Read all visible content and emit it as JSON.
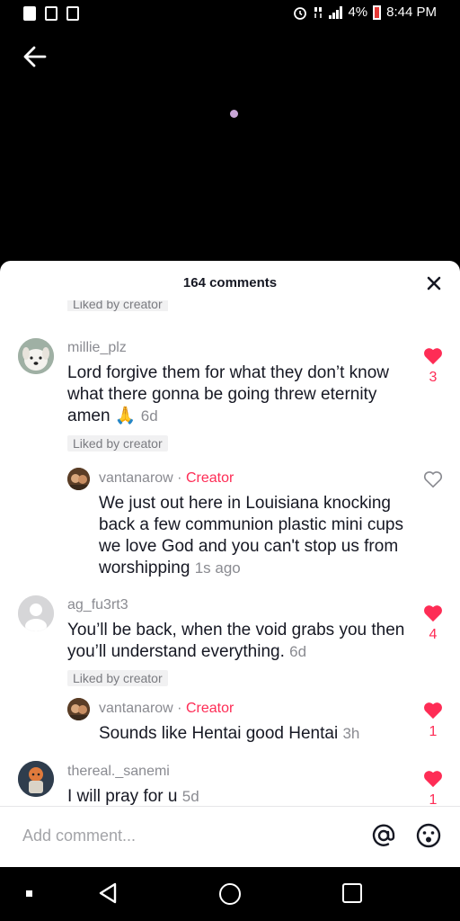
{
  "status_bar": {
    "battery": "4%",
    "time": "8:44 PM"
  },
  "header": {
    "title": "164 comments"
  },
  "comments": [
    {
      "username": "millie_plz",
      "text": "Lord forgive them for what they don’t know what there gonna be going threw eternity amen 🙏",
      "time": "6d",
      "liked_tag": "Liked by creator",
      "likes": "3",
      "reply": {
        "username": "vantanarow",
        "separator": " · ",
        "creator_label": "Creator",
        "text": "We just out here in Louisiana knocking back a few communion plastic mini cups we love God and you can't stop us from worshipping",
        "time": "1s ago"
      }
    },
    {
      "username": "ag_fu3rt3",
      "text": "You’ll be back, when the void grabs you then you’ll understand everything.",
      "time": "6d",
      "liked_tag": "Liked by creator",
      "likes": "4",
      "reply": {
        "username": "vantanarow",
        "separator": " · ",
        "creator_label": "Creator",
        "text": "Sounds like Hentai good Hentai",
        "time": "3h",
        "likes": "1"
      }
    },
    {
      "username": "thereal._sanemi",
      "text": "I will pray for u",
      "time": "5d",
      "likes": "1"
    }
  ],
  "top_clipped_tag": "Liked by creator",
  "input": {
    "placeholder": "Add comment..."
  },
  "colors": {
    "accent": "#fe2c55",
    "text": "#161823",
    "muted": "#8a8b91"
  }
}
